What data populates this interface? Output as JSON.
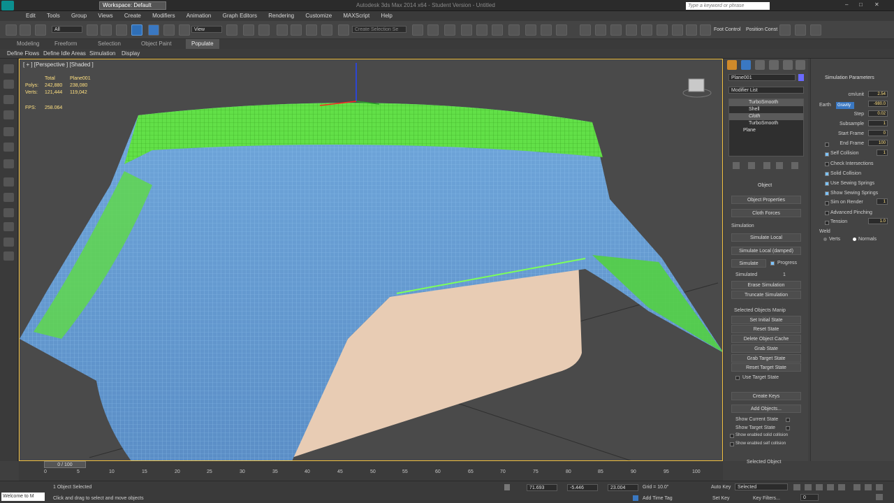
{
  "title": {
    "workspace": "Workspace: Default",
    "app_title": "Autodesk 3ds Max 2014 x64",
    "version": "Student Version",
    "file": "Untitled",
    "search_placeholder": "Type a keyword or phrase"
  },
  "menu": [
    "Edit",
    "Tools",
    "Group",
    "Views",
    "Create",
    "Modifiers",
    "Animation",
    "Graph Editors",
    "Rendering",
    "Customize",
    "MAXScript",
    "Help"
  ],
  "toolbar": {
    "selection_filter": "All",
    "ref_coord": "View",
    "named_sel": "Create Selection Se",
    "foot_control": "Foot Control",
    "position_const": "Position Const"
  },
  "ribbon_tabs": [
    "Modeling",
    "Freeform",
    "Selection",
    "Object Paint",
    "Populate"
  ],
  "ribbon_sub": [
    "Define Flows",
    "Define Idle Areas",
    "Simulation",
    "Display"
  ],
  "viewport": {
    "label": "[ + ] [Perspective ] [Shaded ]",
    "stats_header_total": "Total",
    "stats_header_obj": "Plane001",
    "polys_label": "Polys:",
    "polys_total": "242,880",
    "polys_obj": "238,080",
    "verts_label": "Verts:",
    "verts_total": "121,444",
    "verts_obj": "119,042",
    "fps_label": "FPS:",
    "fps": "258.064"
  },
  "cmd": {
    "object_name": "Plane001",
    "modifier_list": "Modifier List",
    "stack": [
      "TurboSmooth",
      "Shell",
      "Cloth",
      "TurboSmooth",
      "Plane"
    ],
    "object_section": "Object",
    "object_properties": "Object Properties",
    "cloth_forces": "Cloth Forces",
    "simulation_section": "Simulation",
    "simulate_local": "Simulate Local",
    "simulate_local_damped": "Simulate Local (damped)",
    "simulate": "Simulate",
    "progress": "Progress",
    "simulated": "Simulated",
    "simulated_value": "1",
    "erase_simulation": "Erase Simulation",
    "truncate_simulation": "Truncate Simulation",
    "selected_objects_manip": "Selected Objects Manip",
    "set_initial_state": "Set Initial State",
    "reset_state": "Reset State",
    "delete_object_cache": "Delete Object Cache",
    "grab_state": "Grab State",
    "grab_target_state": "Grab Target State",
    "reset_target_state": "Reset Target State",
    "use_target_state": "Use Target State",
    "create_keys": "Create Keys",
    "add_objects": "Add Objects...",
    "show_current_state": "Show Current State",
    "show_target_state": "Show Target State",
    "show_enabled_solid": "Show enabled solid collision",
    "show_enabled_self": "Show enabled self collision",
    "selected_object": "Selected Object"
  },
  "sim_params": {
    "title": "Simulation Parameters",
    "cm_unit_label": "cm/unit",
    "cm_unit": "2.54",
    "earth": "Earth",
    "gravity_label": "Gravity",
    "gravity": "-980.0",
    "step_label": "Step",
    "step": "0.02",
    "subsample_label": "Subsample",
    "subsample": "1",
    "start_frame_label": "Start Frame",
    "start_frame": "0",
    "end_frame_label": "End Frame",
    "end_frame": "100",
    "self_collision_label": "Self Collision",
    "self_collision": "1",
    "check_intersections": "Check Intersections",
    "solid_collision": "Solid Collision",
    "use_sewing_springs": "Use Sewing Springs",
    "show_sewing_springs": "Show Sewing Springs",
    "sim_on_render_label": "Sim on Render",
    "sim_on_render": "1",
    "advanced_pinching": "Advanced Pinching",
    "tension_label": "Tension",
    "tension": "1.0",
    "weld": "Weld",
    "verts": "Verts",
    "normals": "Normals"
  },
  "timeline": {
    "slider": "0 / 100",
    "ticks": [
      "0",
      "5",
      "10",
      "15",
      "20",
      "25",
      "30",
      "35",
      "40",
      "45",
      "50",
      "55",
      "60",
      "65",
      "70",
      "75",
      "80",
      "85",
      "90",
      "95",
      "100"
    ]
  },
  "status": {
    "welcome": "Welcome to M",
    "selected": "1 Object Selected",
    "prompt": "Click and drag to select and move objects",
    "x": "71.693",
    "y": "-5.446",
    "z": "23.004",
    "grid": "Grid = 10.0\"",
    "add_time_tag": "Add Time Tag",
    "auto_key": "Auto Key",
    "set_key": "Set Key",
    "selected_dropdown": "Selected",
    "key_filters": "Key Filters...",
    "frame": "0"
  }
}
